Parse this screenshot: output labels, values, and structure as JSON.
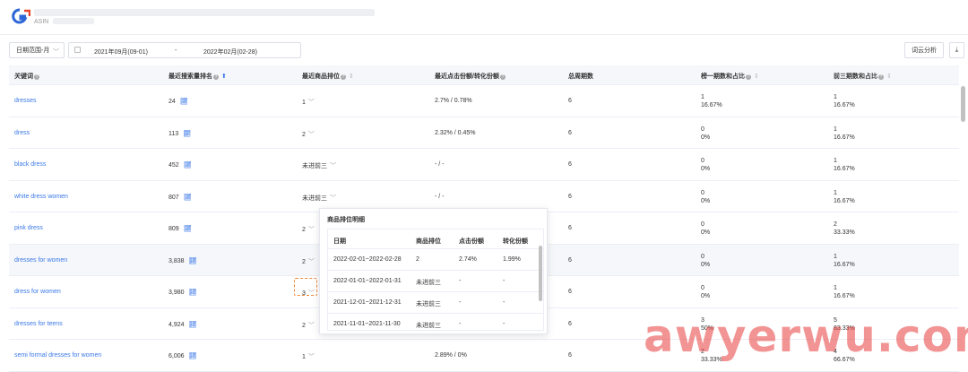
{
  "header": {
    "asin_label": "ASIN"
  },
  "toolbar": {
    "range_label": "日期范围-月",
    "date_start": "2021年09月(09-01)",
    "date_sep": "-",
    "date_end": "2022年02月(02-28)",
    "cloud_button": "词云分析"
  },
  "table": {
    "columns": [
      "关键词",
      "最近搜索量排名",
      "最近商品排位",
      "最近点击份额/转化份额",
      "总周期数",
      "榜一期数和占比",
      "前三期数和占比"
    ],
    "rows": [
      {
        "keyword": "dresses",
        "search_rank": "24",
        "rank": "1",
        "share": "2.7% / 0.78%",
        "periods": "6",
        "top1_count": "1",
        "top1_pct": "16.67%",
        "top3_count": "1",
        "top3_pct": "16.67%"
      },
      {
        "keyword": "dress",
        "search_rank": "113",
        "rank": "2",
        "share": "2.32% / 0.45%",
        "periods": "6",
        "top1_count": "0",
        "top1_pct": "0%",
        "top3_count": "1",
        "top3_pct": "16.67%"
      },
      {
        "keyword": "black dress",
        "search_rank": "452",
        "rank": "未进前三",
        "share": "- / -",
        "periods": "6",
        "top1_count": "0",
        "top1_pct": "0%",
        "top3_count": "1",
        "top3_pct": "16.67%"
      },
      {
        "keyword": "white dress women",
        "search_rank": "807",
        "rank": "未进前三",
        "share": "- / -",
        "periods": "6",
        "top1_count": "0",
        "top1_pct": "0%",
        "top3_count": "1",
        "top3_pct": "16.67%"
      },
      {
        "keyword": "pink dress",
        "search_rank": "809",
        "rank": "2",
        "share": "",
        "periods": "6",
        "top1_count": "0",
        "top1_pct": "0%",
        "top3_count": "2",
        "top3_pct": "33.33%"
      },
      {
        "keyword": "dresses for women",
        "search_rank": "3,838",
        "rank": "2",
        "share": "",
        "periods": "6",
        "top1_count": "0",
        "top1_pct": "0%",
        "top3_count": "1",
        "top3_pct": "16.67%"
      },
      {
        "keyword": "dress for women",
        "search_rank": "3,980",
        "rank": "3",
        "share": "",
        "periods": "6",
        "top1_count": "0",
        "top1_pct": "0%",
        "top3_count": "1",
        "top3_pct": "16.67%"
      },
      {
        "keyword": "dresses for teens",
        "search_rank": "4,924",
        "rank": "2",
        "share": "",
        "periods": "6",
        "top1_count": "3",
        "top1_pct": "50%",
        "top3_count": "5",
        "top3_pct": "83.33%"
      },
      {
        "keyword": "semi formal dresses for women",
        "search_rank": "6,006",
        "rank": "1",
        "share": "2.89% / 0%",
        "periods": "6",
        "top1_count": "2",
        "top1_pct": "33.33%",
        "top3_count": "4",
        "top3_pct": "66.67%"
      }
    ]
  },
  "popover": {
    "title": "商品排位明细",
    "columns": [
      "日期",
      "商品排位",
      "点击份额",
      "转化份额"
    ],
    "rows": [
      {
        "date": "2022-02-01~2022-02-28",
        "rank": "2",
        "click": "2.74%",
        "conv": "1.99%"
      },
      {
        "date": "2022-01-01~2022-01-31",
        "rank": "未进前三",
        "click": "-",
        "conv": "-"
      },
      {
        "date": "2021-12-01~2021-12-31",
        "rank": "未进前三",
        "click": "-",
        "conv": "-"
      },
      {
        "date": "2021-11-01~2021-11-30",
        "rank": "未进前三",
        "click": "-",
        "conv": "-"
      }
    ]
  },
  "watermark": "awyerwu.com",
  "colors": {
    "link": "#3a78e8",
    "highlight": "#f08a3c",
    "watermark": "#e83c3c"
  }
}
